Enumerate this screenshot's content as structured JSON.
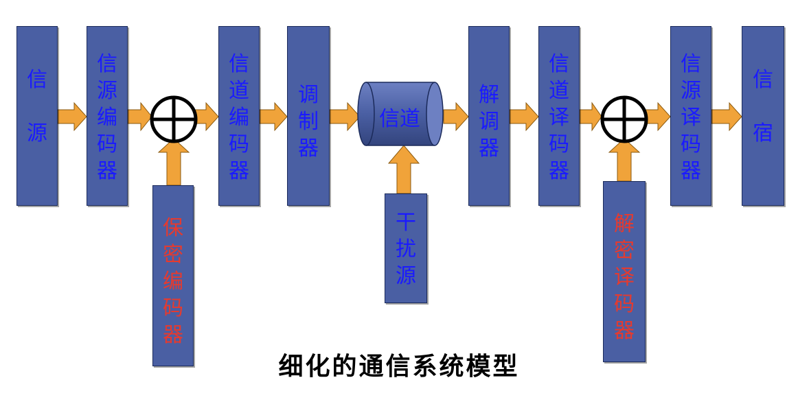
{
  "title": "细化的通信系统模型",
  "blocks": {
    "source": "信\n\n源",
    "source_encoder": "信\n源\n编\n码\n器",
    "channel_encoder": "信\n道\n编\n码\n器",
    "modulator": "调\n制\n器",
    "channel": "信道",
    "demodulator": "解\n调\n器",
    "channel_decoder": "信\n道\n译\n码\n器",
    "source_decoder": "信\n源\n译\n码\n器",
    "sink": "信\n\n宿",
    "encryption": "保\n密\n编\n码\n器",
    "noise": "干\n扰\n源",
    "decryption": "解\n密\n译\n码\n器"
  },
  "colors": {
    "block_fill": "#4a5fa3",
    "arrow_fill": "#f0a33a",
    "label_blue": "#1a1aff",
    "label_red": "#e63a2e"
  }
}
